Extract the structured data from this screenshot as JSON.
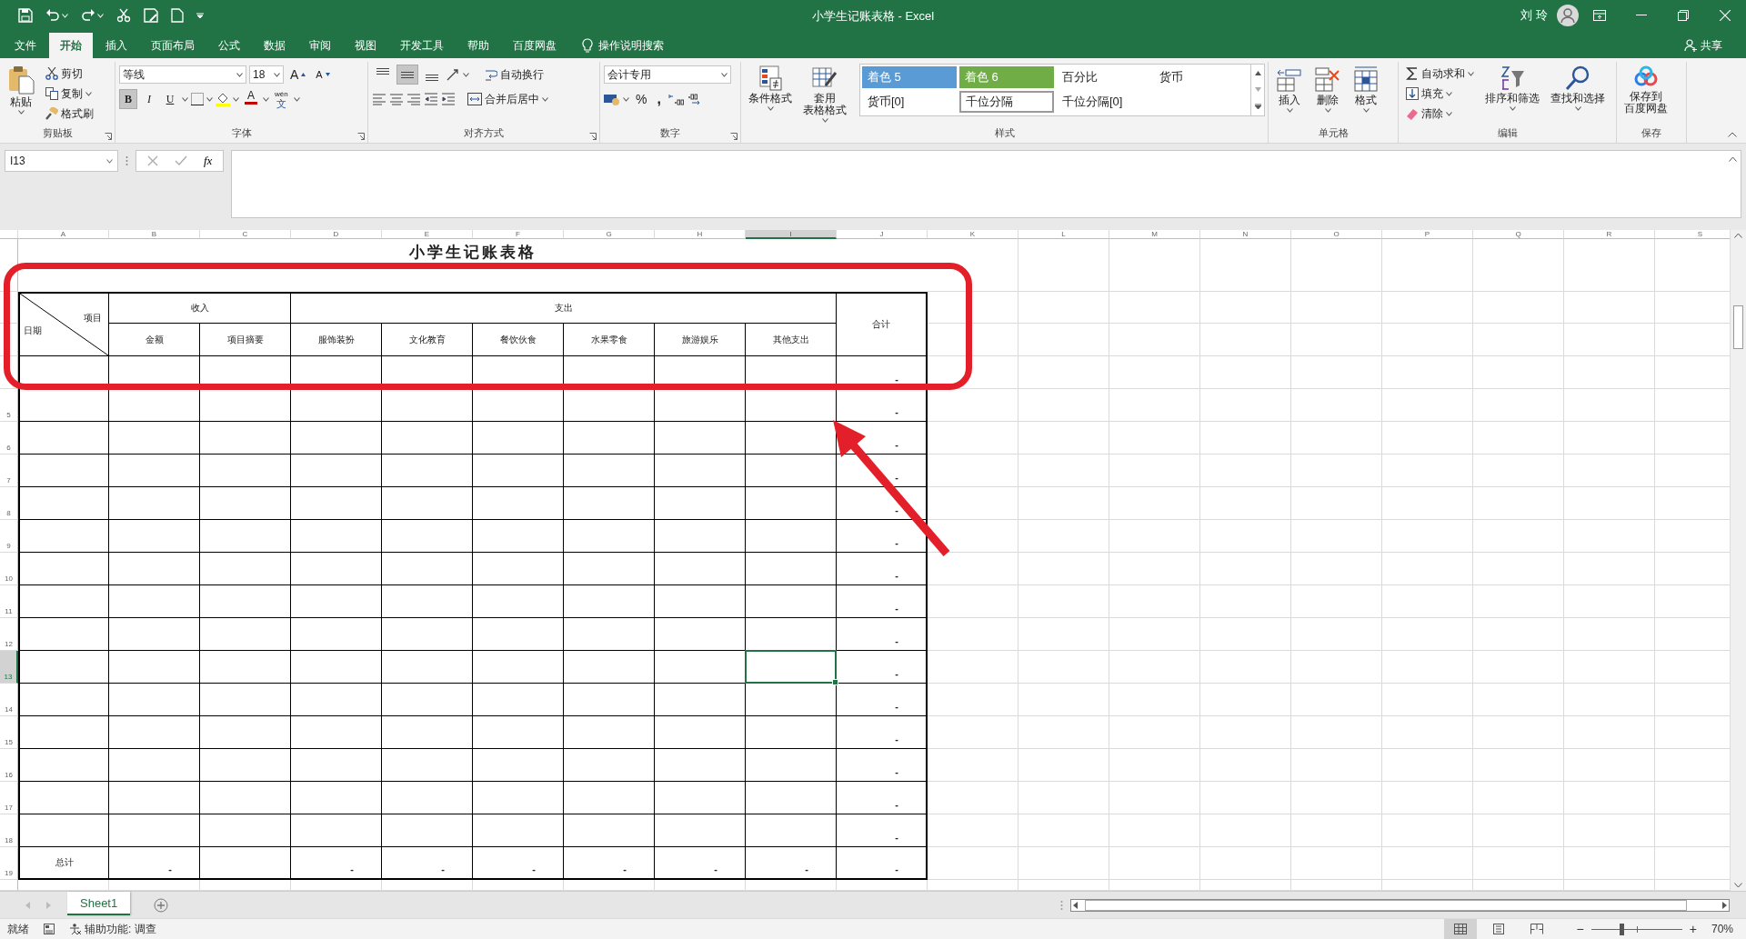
{
  "window": {
    "title": "小学生记账表格 - Excel",
    "user": "刘 玲"
  },
  "menu_tabs": [
    {
      "label": "文件",
      "selected": false
    },
    {
      "label": "开始",
      "selected": true
    },
    {
      "label": "插入",
      "selected": false
    },
    {
      "label": "页面布局",
      "selected": false
    },
    {
      "label": "公式",
      "selected": false
    },
    {
      "label": "数据",
      "selected": false
    },
    {
      "label": "审阅",
      "selected": false
    },
    {
      "label": "视图",
      "selected": false
    },
    {
      "label": "开发工具",
      "selected": false
    },
    {
      "label": "帮助",
      "selected": false
    },
    {
      "label": "百度网盘",
      "selected": false
    }
  ],
  "tell_me": "操作说明搜索",
  "share": "共享",
  "ribbon": {
    "clipboard": {
      "label": "剪贴板",
      "paste": "粘贴",
      "items": [
        "剪切",
        "复制",
        "格式刷"
      ]
    },
    "font": {
      "label": "字体",
      "name": "等线",
      "size": "18",
      "grow": "A",
      "shrink": "A",
      "styles": [
        {
          "label": "B",
          "on": true
        },
        {
          "label": "I",
          "on": false
        },
        {
          "label": "U",
          "on": false
        }
      ],
      "font_color": "A",
      "phonetic": "wén",
      "phonetic_sub": "文"
    },
    "alignment": {
      "label": "对齐方式",
      "vertical": [
        {
          "selected": false
        },
        {
          "selected": true
        },
        {
          "selected": false
        }
      ],
      "wrap": "自动换行",
      "merge": "合并后居中"
    },
    "number": {
      "label": "数字",
      "format": "会计专用",
      "percent": "%",
      "comma": ","
    },
    "styles": {
      "label": "样式",
      "conditional": "条件格式",
      "table_format": [
        "套用",
        "表格格式"
      ],
      "gallery": [
        {
          "label": "着色 5",
          "kind": "accent",
          "color": "#5b9bd5",
          "selected": false
        },
        {
          "label": "着色 6",
          "kind": "accent",
          "color": "#70ad47",
          "selected": false
        },
        {
          "label": "百分比",
          "kind": "plain",
          "selected": false
        },
        {
          "label": "货币",
          "kind": "plain",
          "selected": false
        },
        {
          "label": "货币[0]",
          "kind": "plain",
          "selected": false
        },
        {
          "label": "千位分隔",
          "kind": "plain",
          "selected": true
        },
        {
          "label": "千位分隔[0]",
          "kind": "plain",
          "selected": false
        }
      ]
    },
    "cells": {
      "label": "单元格",
      "buttons": [
        "插入",
        "删除",
        "格式"
      ]
    },
    "editing": {
      "label": "编辑",
      "items": [
        "自动求和",
        "填充",
        "清除"
      ],
      "buttons": [
        "排序和筛选",
        "查找和选择"
      ]
    },
    "save": {
      "label": "保存",
      "button": [
        "保存到",
        "百度网盘"
      ]
    }
  },
  "formula_bar": {
    "name_box": "I13",
    "fx": "fx"
  },
  "sheet": {
    "columns": [
      {
        "label": "A",
        "selected": false
      },
      {
        "label": "B",
        "selected": false
      },
      {
        "label": "C",
        "selected": false
      },
      {
        "label": "D",
        "selected": false
      },
      {
        "label": "E",
        "selected": false
      },
      {
        "label": "F",
        "selected": false
      },
      {
        "label": "G",
        "selected": false
      },
      {
        "label": "H",
        "selected": false
      },
      {
        "label": "I",
        "selected": true
      },
      {
        "label": "J",
        "selected": false
      },
      {
        "label": "K",
        "selected": false
      },
      {
        "label": "L",
        "selected": false
      },
      {
        "label": "M",
        "selected": false
      },
      {
        "label": "N",
        "selected": false
      },
      {
        "label": "O",
        "selected": false
      },
      {
        "label": "P",
        "selected": false
      },
      {
        "label": "Q",
        "selected": false
      },
      {
        "label": "R",
        "selected": false
      },
      {
        "label": "S",
        "selected": false
      }
    ],
    "title": "小学生记账表格",
    "header": {
      "item": "项目",
      "date": "日期",
      "income": "收入",
      "expense": "支出",
      "total": "合计",
      "subheads": [
        "金额",
        "项目摘要",
        "服饰装扮",
        "文化教育",
        "餐饮伙食",
        "水果零食",
        "旅游娱乐",
        "其他支出"
      ]
    },
    "rows": [
      {
        "total": "-"
      },
      {
        "total": "-"
      },
      {
        "total": "-"
      },
      {
        "total": "-"
      },
      {
        "total": "-"
      },
      {
        "total": "-"
      },
      {
        "total": "-"
      },
      {
        "total": "-"
      },
      {
        "total": "-"
      },
      {
        "total": "-"
      },
      {
        "total": "-"
      },
      {
        "total": "-"
      },
      {
        "total": "-"
      },
      {
        "total": "-"
      },
      {
        "total": "-"
      }
    ],
    "total_row": {
      "label": "总计",
      "amount": "-",
      "expenses": [
        "-",
        "-",
        "-",
        "-",
        "-",
        "-"
      ],
      "total": "-"
    },
    "row_numbers": [
      {
        "label": "5",
        "selected": false
      },
      {
        "label": "6",
        "selected": false
      },
      {
        "label": "7",
        "selected": false
      },
      {
        "label": "8",
        "selected": false
      },
      {
        "label": "9",
        "selected": false
      },
      {
        "label": "10",
        "selected": false
      },
      {
        "label": "11",
        "selected": false
      },
      {
        "label": "12",
        "selected": false
      },
      {
        "label": "13",
        "selected": true
      },
      {
        "label": "14",
        "selected": false
      },
      {
        "label": "15",
        "selected": false
      },
      {
        "label": "16",
        "selected": false
      },
      {
        "label": "17",
        "selected": false
      },
      {
        "label": "18",
        "selected": false
      },
      {
        "label": "19",
        "selected": false
      }
    ]
  },
  "sheet_tabs": [
    {
      "label": "Sheet1",
      "selected": true
    }
  ],
  "status_bar": {
    "ready": "就绪",
    "accessibility": "辅助功能: 调查",
    "views": [
      {
        "selected": true
      },
      {
        "selected": false
      },
      {
        "selected": false
      }
    ],
    "zoom_out": "−",
    "zoom_in": "+",
    "zoom": {
      "level": 0.33
    },
    "zoom_label": "70%"
  },
  "annotations": {
    "frame": true,
    "arrow": true
  }
}
